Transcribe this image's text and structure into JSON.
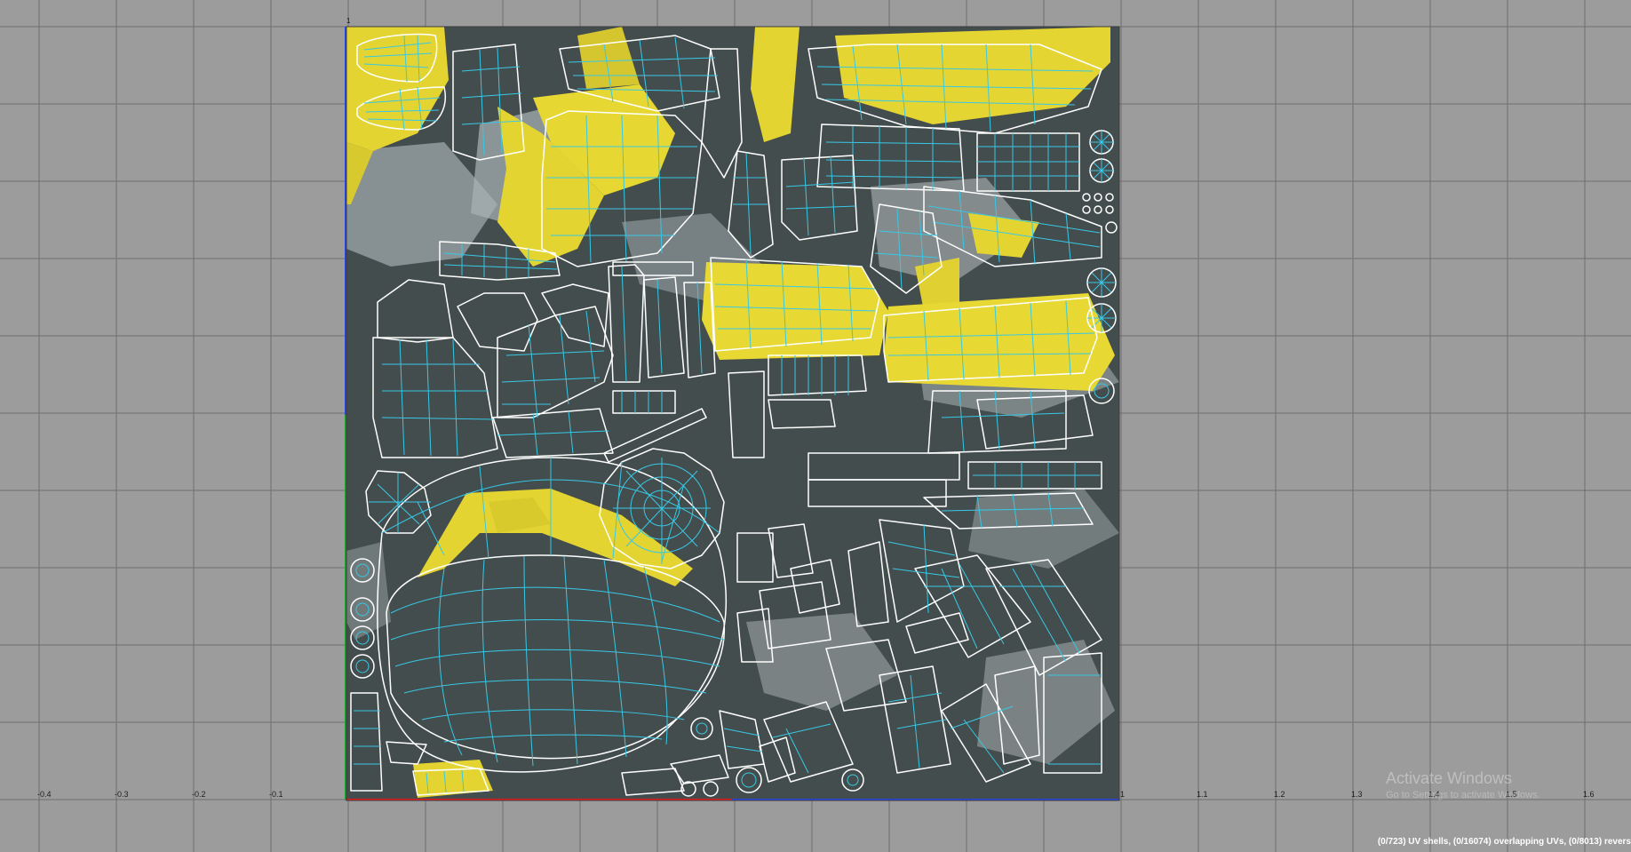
{
  "editor": {
    "type": "uv-texture-editor",
    "corner_label": "1"
  },
  "axis": {
    "u_labels": [
      "-0.4",
      "-0.3",
      "-0.2",
      "-0.1",
      "1",
      "1.1",
      "1.2",
      "1.3",
      "1.4",
      "1.5",
      "1.6"
    ]
  },
  "status": {
    "text": "(0/723) UV shells, (0/16074) overlapping UVs, (0/8013) revers"
  },
  "watermark": {
    "line1": "Activate Windows",
    "line2": "Go to Settings to activate Windows."
  },
  "colors": {
    "background": "#9c9c9c",
    "grid": "#6f6f6f",
    "texture_base": "#444d4d",
    "texture_highlight": "#e4d432",
    "texture_light": "#aab2b5",
    "uv_shell_border": "#ffffff",
    "uv_edges": "#37c8e6",
    "u_axis": "#e01e1e",
    "v_axis": "#2b45d8",
    "v_axis_lower": "#1fa22f"
  }
}
